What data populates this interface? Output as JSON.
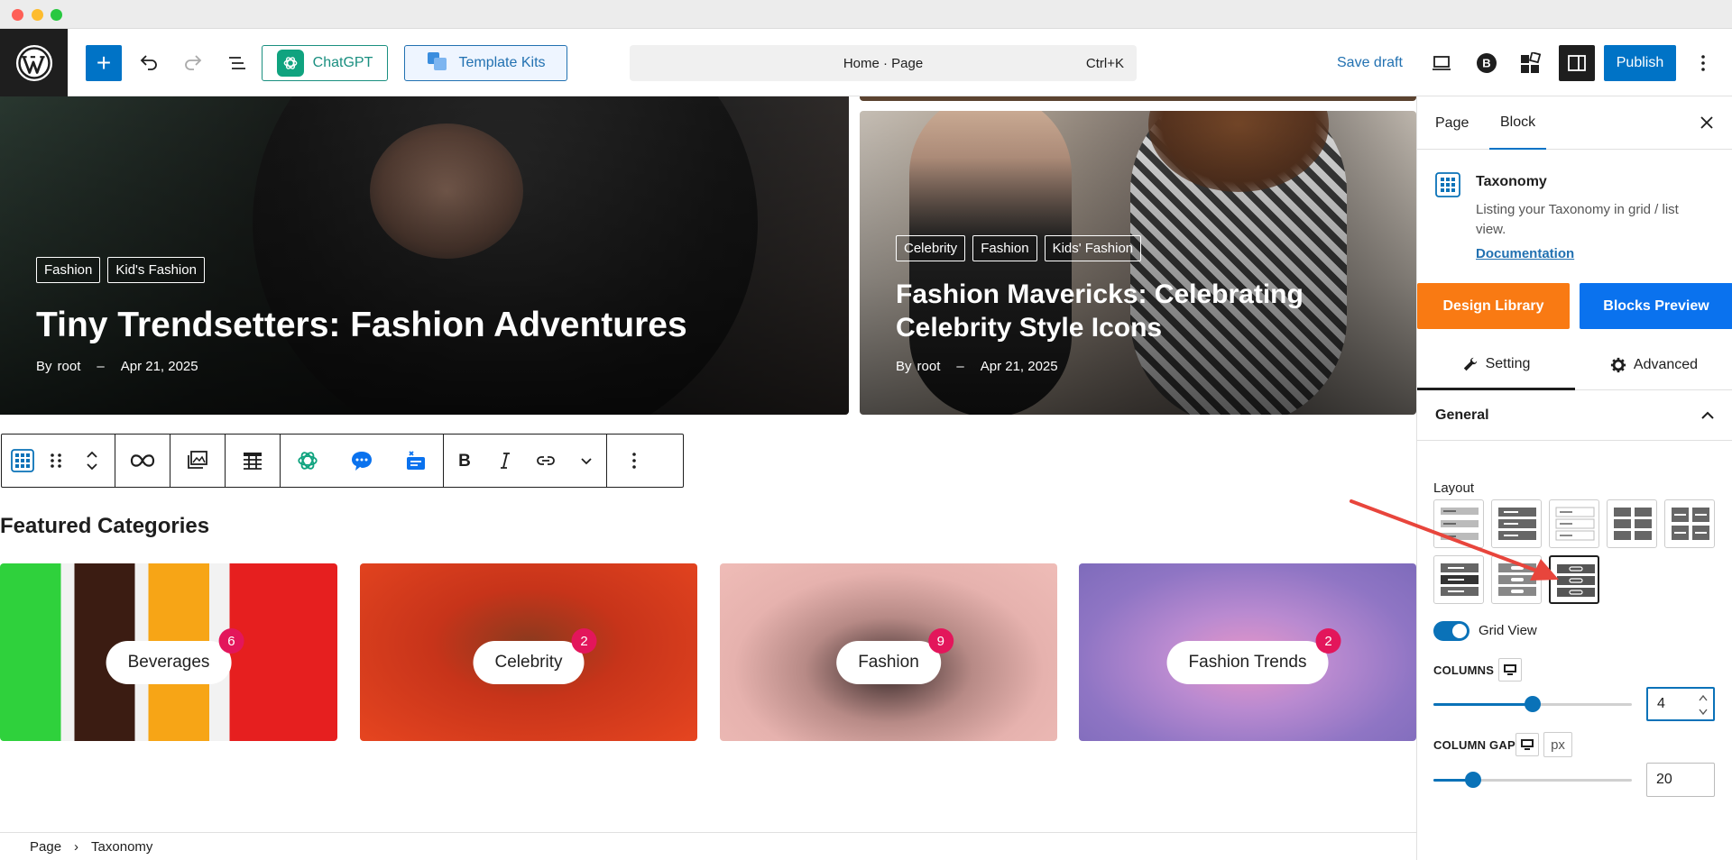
{
  "toolbar": {
    "chatgpt_label": "ChatGPT",
    "template_kits_label": "Template Kits",
    "command_bar_text": "Home · Page",
    "command_shortcut": "Ctrl+K",
    "save_draft_label": "Save draft",
    "publish_label": "Publish",
    "b_badge": "B"
  },
  "hero": {
    "left": {
      "tags": [
        "Fashion",
        "Kid's Fashion"
      ],
      "title": "Tiny Trendsetters: Fashion Adventures",
      "by": "By",
      "author": "root",
      "sep": "–",
      "date": "Apr 21, 2025"
    },
    "right": {
      "tags": [
        "Celebrity",
        "Fashion",
        "Kids' Fashion"
      ],
      "title_line1": "Fashion Mavericks: Celebrating",
      "title_line2": "Celebrity Style Icons",
      "by": "By",
      "author": "root",
      "sep": "–",
      "date": "Apr 21, 2025"
    }
  },
  "section_title": "Featured Categories",
  "categories": [
    {
      "name": "Beverages",
      "count": "6"
    },
    {
      "name": "Celebrity",
      "count": "2"
    },
    {
      "name": "Fashion",
      "count": "9"
    },
    {
      "name": "Fashion Trends",
      "count": "2"
    }
  ],
  "breadcrumb": {
    "root": "Page",
    "current": "Taxonomy"
  },
  "sidebar": {
    "tabs": [
      "Page",
      "Block"
    ],
    "block_name": "Taxonomy",
    "block_desc": "Listing your Taxonomy in grid / list view.",
    "doc_link": "Documentation",
    "design_library": "Design Library",
    "blocks_preview": "Blocks Preview",
    "setting_tab": "Setting",
    "advanced_tab": "Advanced",
    "general": "General",
    "layout_label": "Layout",
    "grid_view_label": "Grid View",
    "columns_label": "COLUMNS",
    "columns_value": "4",
    "columns_slider_fraction": 0.5,
    "column_gap_label": "COLUMN GAP",
    "column_gap_unit": "px",
    "column_gap_value": "20",
    "column_gap_slider_fraction": 0.2
  },
  "colors": {
    "wp_blue": "#0073c6",
    "chatgpt_green": "#10a37f",
    "design_library_orange": "#f97a13",
    "blocks_preview_blue": "#0a72ee",
    "count_badge": "#e3165b",
    "annotation_arrow": "#e8453c"
  }
}
